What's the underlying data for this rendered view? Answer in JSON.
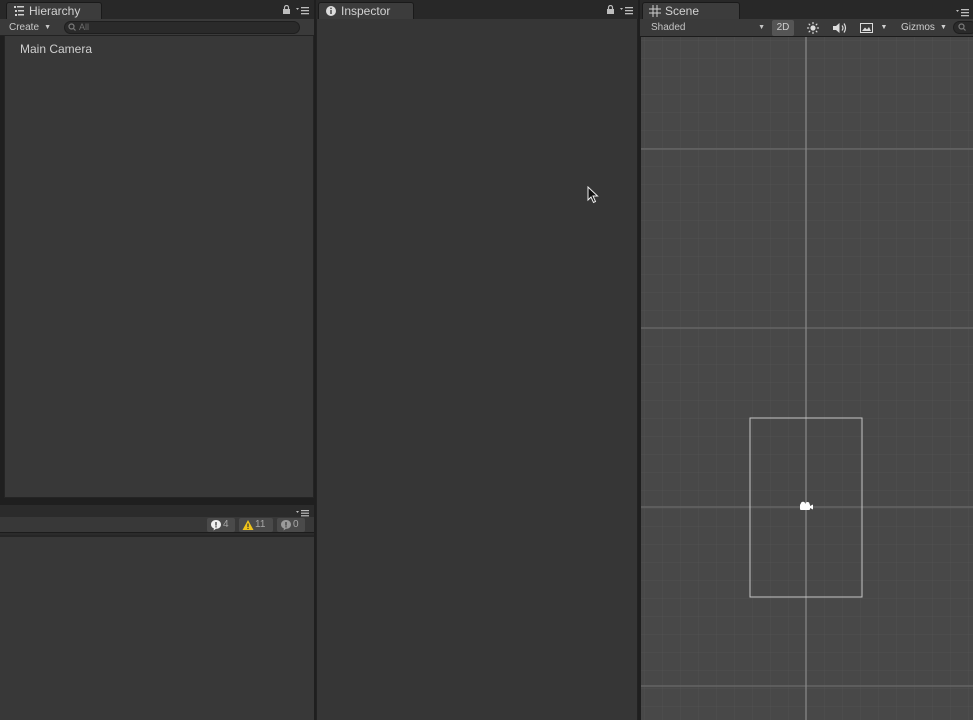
{
  "hierarchy": {
    "tab_label": "Hierarchy",
    "create_label": "Create",
    "search_placeholder": "All",
    "items": [
      {
        "label": "Main Camera"
      }
    ]
  },
  "console": {
    "error_count": "4",
    "warning_count": "11",
    "message_count": "0"
  },
  "inspector": {
    "tab_label": "Inspector"
  },
  "scene": {
    "tab_label": "Scene",
    "shading_mode": "Shaded",
    "mode_2d_label": "2D",
    "gizmos_label": "Gizmos"
  },
  "icons": {
    "hierarchy_tab": "list-icon",
    "inspector_tab": "info-icon",
    "scene_tab": "grid-icon",
    "lock": "lock-icon",
    "panel_menu": "menu-icon",
    "search": "search-icon",
    "console_error": "error-icon",
    "console_warning": "warning-icon",
    "console_message": "message-icon",
    "lighting": "sun-icon",
    "audio": "speaker-icon",
    "effects": "image-icon",
    "camera": "camera-icon"
  },
  "colors": {
    "panel_bg": "#383838",
    "scene_bg": "#484848",
    "warning": "#f0c419",
    "tab_active": "#3c3c3c"
  }
}
